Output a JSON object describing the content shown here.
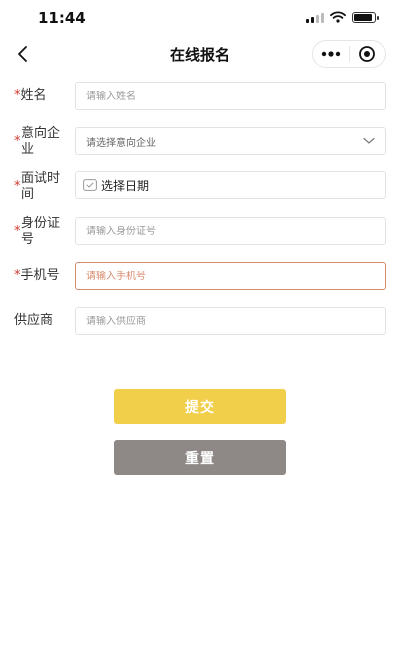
{
  "status_bar": {
    "time": "11:44",
    "battery_level": 0.9
  },
  "nav": {
    "title": "在线报名"
  },
  "form": {
    "required_mark": "*",
    "name": {
      "label": "姓名",
      "placeholder": "请输入姓名",
      "value": ""
    },
    "company": {
      "label_line1": "意向企",
      "label_line2": "业",
      "placeholder": "请选择意向企业"
    },
    "interview_time": {
      "label_line1": "面试时",
      "label_line2": "间",
      "value": "选择日期"
    },
    "id_number": {
      "label_line1": "身份证",
      "label_line2": "号",
      "placeholder": "请输入身份证号",
      "value": ""
    },
    "phone": {
      "label": "手机号",
      "placeholder": "请输入手机号",
      "value": ""
    },
    "supplier": {
      "label": "供应商",
      "placeholder": "请输入供应商",
      "value": ""
    }
  },
  "buttons": {
    "submit": "提交",
    "reset": "重置"
  },
  "colors": {
    "accent": "#f2cf4a",
    "reset": "#8e8886",
    "required": "#d23b2f",
    "focus_border": "#d88a6e"
  }
}
